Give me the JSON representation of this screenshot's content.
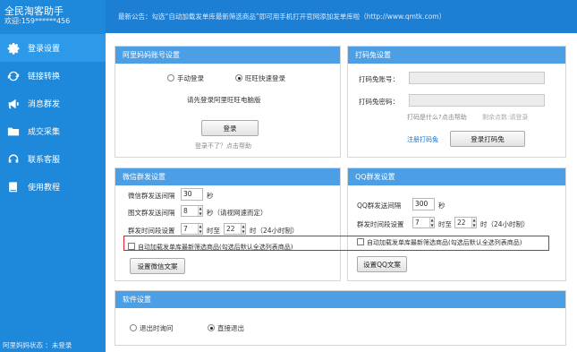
{
  "app": {
    "title": "全民淘客助手",
    "welcome": "欢迎:159******456",
    "status": "阿里妈妈状态 ：未登录"
  },
  "header": {
    "notice": "最新公告：勾选“自动加载发单库最新筛选商品”即可用手机打开官网添加发单库啦（http://www.qmtk.com）"
  },
  "nav": {
    "items": [
      {
        "label": "登录设置",
        "icon": "gear-icon",
        "active": true
      },
      {
        "label": "链接转换",
        "icon": "refresh-icon",
        "active": false
      },
      {
        "label": "消息群发",
        "icon": "megaphone-icon",
        "active": false
      },
      {
        "label": "成交采集",
        "icon": "folder-icon",
        "active": false
      },
      {
        "label": "联系客服",
        "icon": "headset-icon",
        "active": false
      },
      {
        "label": "使用教程",
        "icon": "book-icon",
        "active": false
      }
    ]
  },
  "alimama": {
    "title": "阿里妈妈账号设置",
    "opt_manual": "手动登录",
    "opt_fast": "旺旺快速登录",
    "hint_link": "请先登录阿里旺旺电脑版",
    "login_btn": "登录",
    "help_text": "登录不了？点击帮助"
  },
  "captcha": {
    "title": "打码兔设置",
    "account_label": "打码兔账号：",
    "password_label": "打码兔密码：",
    "account_value": "",
    "password_value": "",
    "what_link": "打码是什么?点击帮助",
    "balance_text": "剩余点数:请登录",
    "register_link": "注册打码兔",
    "login_btn": "登录打码兔"
  },
  "wechat": {
    "title": "微信群发设置",
    "interval_label": "微信群发送间隔",
    "interval_value": "30",
    "interval_unit": "秒",
    "image_label": "图文群发送间隔",
    "image_value": "8",
    "image_unit": "秒（请视网速而定）",
    "time_label": "群发时间段设置",
    "time_from": "7",
    "time_mid": "时至",
    "time_to": "22",
    "time_unit": "时（24小时制）",
    "auto_load": "自动加载发单库最新筛选商品(勾选后默认全选列表商品)",
    "set_btn": "设置微信文案"
  },
  "qq": {
    "title": "QQ群发设置",
    "interval_label": "QQ群发送间隔",
    "interval_value": "300",
    "interval_unit": "秒",
    "time_label": "群发时间段设置",
    "time_from": "7",
    "time_mid": "时至",
    "time_to": "22",
    "time_unit": "时（24小时制）",
    "auto_load": "自动加载发单库最新筛选商品(勾选后默认全选列表商品)",
    "set_btn": "设置QQ文案"
  },
  "software": {
    "title": "软件设置",
    "opt_exit_ask": "退出时询问",
    "opt_exit_direct": "直接退出"
  }
}
